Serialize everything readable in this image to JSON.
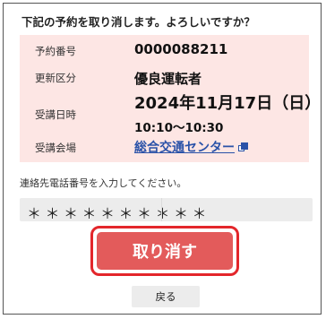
{
  "prompt": "下記の予約を取り消します。よろしいですか？",
  "reservation": {
    "number_label": "予約番号",
    "number_value": "0000088211",
    "class_label": "更新区分",
    "class_value": "優良運転者",
    "date_label": "受講日時",
    "date_value": "2024年11月17日（日）",
    "time_value": "10:10〜10:30",
    "venue_label": "受講会場",
    "venue_value": "総合交通センター"
  },
  "phone": {
    "label": "連絡先電話番号を入力してください。",
    "value": "＊＊＊＊＊＊＊＊＊＊"
  },
  "actions": {
    "cancel_label": "取り消す",
    "back_label": "戻る"
  },
  "colors": {
    "card_bg": "#fde6e4",
    "cancel_button": "#e35b5b",
    "highlight_outline": "#e3262b",
    "link": "#2a52a8"
  },
  "icons": {
    "venue_link_icon": "external-link-icon"
  }
}
